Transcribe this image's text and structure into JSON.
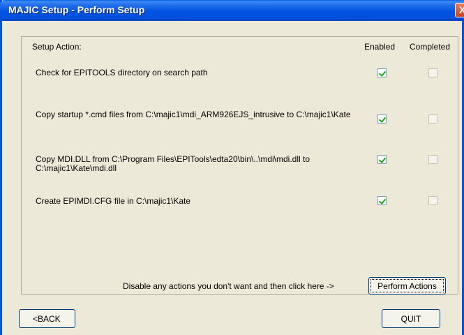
{
  "window": {
    "title": "MAJIC Setup - Perform Setup",
    "close_glyph": "X"
  },
  "table": {
    "headers": {
      "action": "Setup Action:",
      "enabled": "Enabled",
      "completed": "Completed"
    },
    "rows": [
      {
        "text": "Check for EPITOOLS directory on search path",
        "enabled": true,
        "completed": false
      },
      {
        "text": "Copy startup *.cmd files from C:\\majic1\\mdi_ARM926EJS_intrusive to C:\\majic1\\Kate",
        "enabled": true,
        "completed": false
      },
      {
        "text": "Copy MDI.DLL from C:\\Program Files\\EPITools\\edta20\\bin\\..\\mdi\\mdi.dll  to C:\\majic1\\Kate\\mdi.dll",
        "enabled": true,
        "completed": false
      },
      {
        "text": "Create EPIMDI.CFG file in C:\\majic1\\Kate",
        "enabled": true,
        "completed": false
      }
    ]
  },
  "footer": {
    "prompt": "Disable any actions you don't want and then click here ->",
    "perform_label": "Perform Actions",
    "back_label": "<BACK",
    "quit_label": "QUIT"
  }
}
